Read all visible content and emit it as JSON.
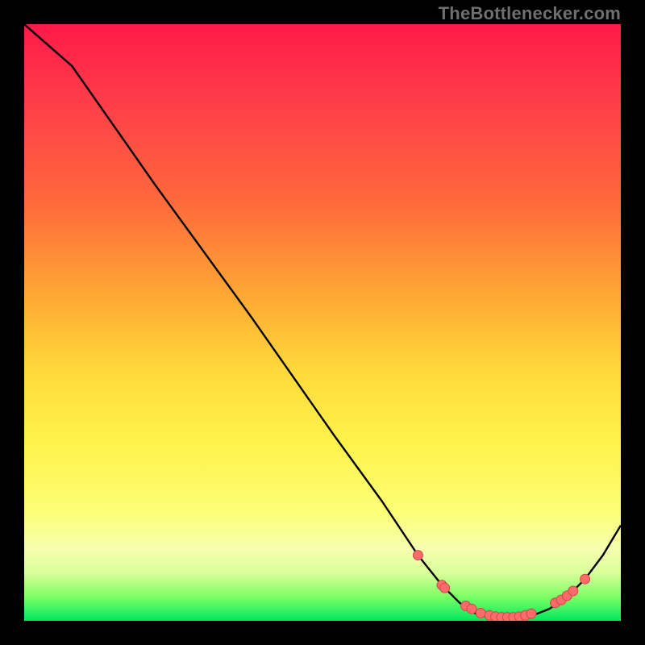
{
  "watermark": "TheBottlenecker.com",
  "colors": {
    "curve": "#000000",
    "marker_fill": "#ff6b6b",
    "marker_stroke": "#c94a4a"
  },
  "chart_data": {
    "type": "line",
    "title": "",
    "xlabel": "",
    "ylabel": "",
    "x_range": [
      0,
      100
    ],
    "y_range": [
      0,
      100
    ],
    "x": [
      0,
      8,
      15,
      22,
      30,
      38,
      45,
      52,
      60,
      66,
      70,
      73,
      76,
      79,
      82,
      85,
      88,
      91,
      94,
      97,
      100
    ],
    "y": [
      100,
      93,
      83,
      73,
      62,
      51,
      41,
      31,
      20,
      11,
      6,
      3,
      1,
      0.5,
      0.5,
      0.8,
      2,
      4,
      7,
      11,
      16
    ],
    "markers": {
      "x": [
        66,
        70,
        70.5,
        74,
        75,
        76.5,
        78,
        79,
        80,
        81,
        82,
        83,
        84,
        85,
        89,
        90,
        91,
        92,
        94
      ],
      "y": [
        11,
        6,
        5.5,
        2.5,
        2,
        1.3,
        0.9,
        0.7,
        0.6,
        0.6,
        0.6,
        0.7,
        0.9,
        1.2,
        3,
        3.5,
        4.2,
        5,
        7
      ]
    }
  }
}
